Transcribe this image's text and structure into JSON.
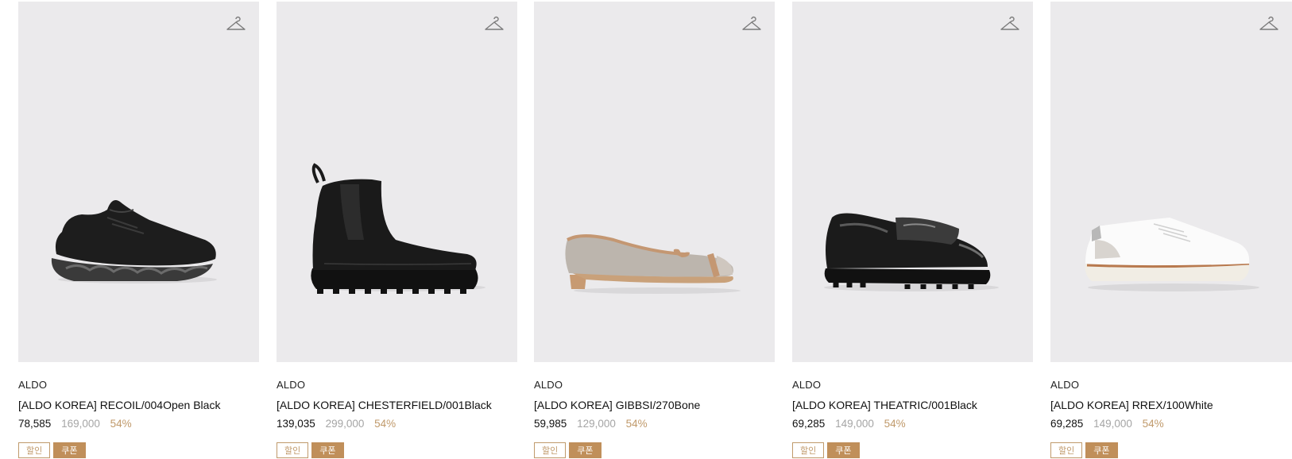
{
  "products": [
    {
      "brand": "ALDO",
      "name": "[ALDO KOREA] RECOIL/004Open Black",
      "price": "78,585",
      "original_price": "169,000",
      "discount": "54%",
      "badges": {
        "sale": "할인",
        "coupon": "쿠폰"
      }
    },
    {
      "brand": "ALDO",
      "name": "[ALDO KOREA] CHESTERFIELD/001Black",
      "price": "139,035",
      "original_price": "299,000",
      "discount": "54%",
      "badges": {
        "sale": "할인",
        "coupon": "쿠폰"
      }
    },
    {
      "brand": "ALDO",
      "name": "[ALDO KOREA] GIBBSI/270Bone",
      "price": "59,985",
      "original_price": "129,000",
      "discount": "54%",
      "badges": {
        "sale": "할인",
        "coupon": "쿠폰"
      }
    },
    {
      "brand": "ALDO",
      "name": "[ALDO KOREA] THEATRIC/001Black",
      "price": "69,285",
      "original_price": "149,000",
      "discount": "54%",
      "badges": {
        "sale": "할인",
        "coupon": "쿠폰"
      }
    },
    {
      "brand": "ALDO",
      "name": "[ALDO KOREA] RREX/100White",
      "price": "69,285",
      "original_price": "149,000",
      "discount": "54%",
      "badges": {
        "sale": "할인",
        "coupon": "쿠폰"
      }
    }
  ],
  "icons": {
    "wishlist": "hanger-icon"
  },
  "colors": {
    "thumb_bg": "#ebeaec",
    "accent": "#c09a6b",
    "coupon_bg": "#c08f5a",
    "original_price": "#a5a5a5"
  }
}
